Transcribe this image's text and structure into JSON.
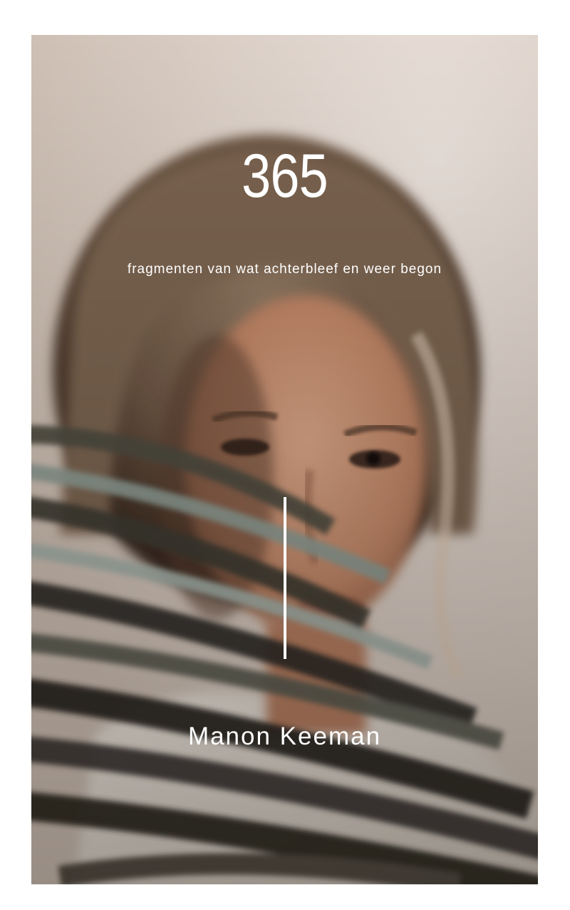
{
  "cover": {
    "title": "365",
    "subtitle": "fragmenten van wat achterbleef en weer begon",
    "author": "Manon Keeman"
  },
  "colors": {
    "text": "#ffffff",
    "background": "#ffffff",
    "wall": "#d9cdc3"
  }
}
